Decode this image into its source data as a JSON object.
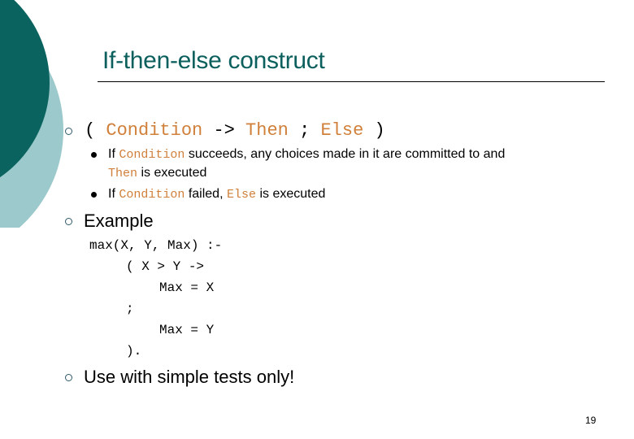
{
  "slide": {
    "title": "If-then-else construct",
    "page_number": "19",
    "colors": {
      "title": "#0b5f5c",
      "dark_circle": "#0b6360",
      "light_circle": "#9cc9cb",
      "code_keyword": "#d0803a"
    }
  },
  "bullets": [
    {
      "syntax": {
        "open": "(",
        "condition": "Condition",
        "arrow": "->",
        "then": "Then",
        "semicolon": ";",
        "else": "Else",
        "close": ")"
      },
      "sub_bullets": [
        {
          "prefix": "If",
          "code1": "Condition",
          "text1": "succeeds, any choices made in it are committed to and",
          "code2": "Then",
          "text2": "is executed"
        },
        {
          "prefix": "If",
          "code1": "Condition",
          "text1": "failed,",
          "code2": "Else",
          "text2": "is executed"
        }
      ]
    },
    {
      "label": "Example",
      "code_lines": [
        "max(X, Y, Max) :-",
        "( X > Y ->",
        "Max = X",
        ";",
        "Max = Y",
        ")."
      ]
    },
    {
      "label": "Use with simple tests only!"
    }
  ]
}
